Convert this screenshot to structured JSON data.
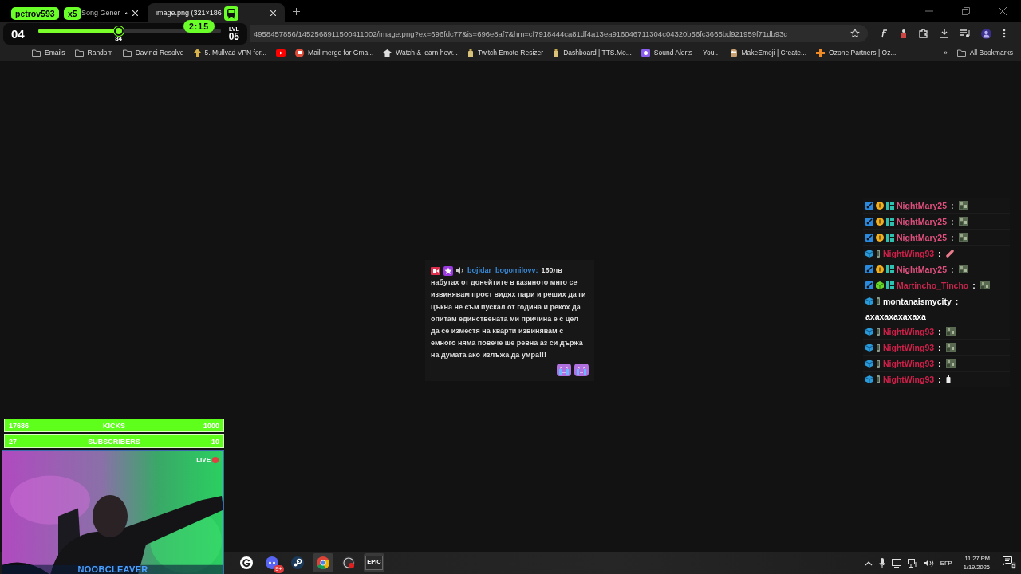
{
  "tabs": [
    {
      "title": "Song Gener",
      "audio": true,
      "selected": false
    },
    {
      "title": "image.png (321×186",
      "audio": false,
      "selected": true
    }
  ],
  "window_controls": [
    {
      "kind": "minimize"
    },
    {
      "kind": "restore"
    },
    {
      "kind": "close"
    }
  ],
  "address_bar": {
    "url": "4958457856/1452568911500411002/image.png?ex=696fdc77&is=696e8af7&hm=cf7918444ca81df4a13ea916046711304c04320b56fc3665bd921959f71db93c"
  },
  "toolbar_icons": [
    {
      "kind": "font"
    },
    {
      "kind": "figure"
    },
    {
      "kind": "puzzle"
    },
    {
      "kind": "download"
    },
    {
      "kind": "playlist"
    },
    {
      "kind": "avatar"
    },
    {
      "kind": "menu"
    }
  ],
  "bookmarks": [
    {
      "label": "Emails",
      "kind": "folder"
    },
    {
      "label": "Random",
      "kind": "folder"
    },
    {
      "label": "Davinci Resolve",
      "kind": "folder"
    },
    {
      "label": "5. Mullvad VPN for...",
      "kind": "arrow"
    },
    {
      "kind": "youtube"
    },
    {
      "label": "Mail merge for Gma...",
      "kind": "redcircle"
    },
    {
      "label": "Watch & learn how...",
      "kind": "cap"
    },
    {
      "label": "Twitch Emote Resizer",
      "kind": "bottle"
    },
    {
      "label": "Dashboard | TTS.Mo...",
      "kind": "bottle"
    },
    {
      "label": "Sound Alerts — You...",
      "kind": "purple"
    },
    {
      "label": "MakeEmoji | Create...",
      "kind": "owl"
    },
    {
      "label": "Ozone Partners | Oz...",
      "kind": "cross"
    }
  ],
  "bookmarks_overflow": "»",
  "all_bookmarks": "All Bookmarks",
  "hud": {
    "player": "petrov593",
    "multiplier": "x5",
    "timer": "2:15",
    "score": "04",
    "level": 0.44,
    "value": "84",
    "level_label": "LVL",
    "level_number": "05"
  },
  "donation": {
    "user": "bojidar_bogomilovv:",
    "amount": "150лв",
    "message": "набутах от донейтите в казиното мнго се извинявам прост видях пари и реших да ги цъкна не съм пускал от година и рекох да опитам единствената ми причина е с цел да се изместя на кварти извинявам с емного няма повече ше ревна аз си държа на думата ако излъжа да умра!!!",
    "emotes": [
      {
        "kind": "crying"
      },
      {
        "kind": "crying"
      }
    ]
  },
  "chat": [
    {
      "badges": [
        {
          "kind": "sword"
        },
        {
          "kind": "coin"
        },
        {
          "kind": "tag"
        }
      ],
      "user": "NightMary25",
      "color": "#e0507e",
      "separator": ":",
      "emote": {
        "kind": "tile"
      }
    },
    {
      "badges": [
        {
          "kind": "sword"
        },
        {
          "kind": "coin"
        },
        {
          "kind": "tag"
        }
      ],
      "user": "NightMary25",
      "color": "#e0507e",
      "separator": ":",
      "emote": {
        "kind": "tile"
      }
    },
    {
      "badges": [
        {
          "kind": "sword"
        },
        {
          "kind": "coin"
        },
        {
          "kind": "tag"
        }
      ],
      "user": "NightMary25",
      "color": "#e0507e",
      "separator": ":",
      "emote": {
        "kind": "tile"
      }
    },
    {
      "badges": [
        {
          "kind": "cube"
        },
        {
          "kind": "figure"
        }
      ],
      "user": "NightWing93",
      "color": "#d0204a",
      "separator": ":",
      "emote": {
        "kind": "sausage"
      }
    },
    {
      "badges": [
        {
          "kind": "sword"
        },
        {
          "kind": "coin"
        },
        {
          "kind": "tag"
        }
      ],
      "user": "NightMary25",
      "color": "#e0507e",
      "separator": ":",
      "emote": {
        "kind": "tile"
      }
    },
    {
      "badges": [
        {
          "kind": "sword"
        },
        {
          "kind": "greencube"
        },
        {
          "kind": "tag"
        }
      ],
      "user": "Martincho_Tincho",
      "color": "#c8264c",
      "separator": ":",
      "emote": {
        "kind": "tile"
      }
    },
    {
      "badges": [
        {
          "kind": "cube"
        },
        {
          "kind": "figure"
        }
      ],
      "user": "montanaismycity",
      "color": "#ffffff",
      "separator": ":",
      "message": "axaxaxaxaxaxa"
    },
    {
      "badges": [
        {
          "kind": "cube"
        },
        {
          "kind": "figure"
        }
      ],
      "user": "NightWing93",
      "color": "#d0204a",
      "separator": ":",
      "emote": {
        "kind": "tile"
      }
    },
    {
      "badges": [
        {
          "kind": "cube"
        },
        {
          "kind": "figure"
        }
      ],
      "user": "NightWing93",
      "color": "#d0204a",
      "separator": ":",
      "emote": {
        "kind": "tile"
      }
    },
    {
      "badges": [
        {
          "kind": "cube"
        },
        {
          "kind": "figure"
        }
      ],
      "user": "NightWing93",
      "color": "#d0204a",
      "separator": ":",
      "emote": {
        "kind": "tile"
      }
    },
    {
      "badges": [
        {
          "kind": "cube"
        },
        {
          "kind": "figure"
        }
      ],
      "user": "NightWing93",
      "color": "#d0204a",
      "separator": ":",
      "emote": {
        "kind": "bottle"
      }
    }
  ],
  "goals": [
    {
      "current": "17686",
      "label": "KICKS",
      "target": "1000"
    },
    {
      "current": "27",
      "label": "SUBSCRIBERS",
      "target": "10"
    }
  ],
  "webcam": {
    "kind": "picture",
    "live": "LIVE",
    "name": "NOOBCLEAVER"
  },
  "taskbar": {
    "apps": [
      {
        "kind": "g",
        "active": false
      },
      {
        "kind": "discord",
        "active": false,
        "badge": "9+"
      },
      {
        "kind": "steam",
        "active": false
      },
      {
        "kind": "chrome",
        "active": true
      },
      {
        "kind": "obs",
        "active": false
      },
      {
        "kind": "epic",
        "active": true,
        "label": "EPIC"
      }
    ],
    "tray_icons": [
      {
        "kind": "caret"
      },
      {
        "kind": "mic"
      },
      {
        "kind": "camera"
      },
      {
        "kind": "network"
      },
      {
        "kind": "speaker"
      }
    ],
    "language": "БГР",
    "time": "11:27 PM",
    "date": "1/19/2026",
    "notifications": "5"
  }
}
